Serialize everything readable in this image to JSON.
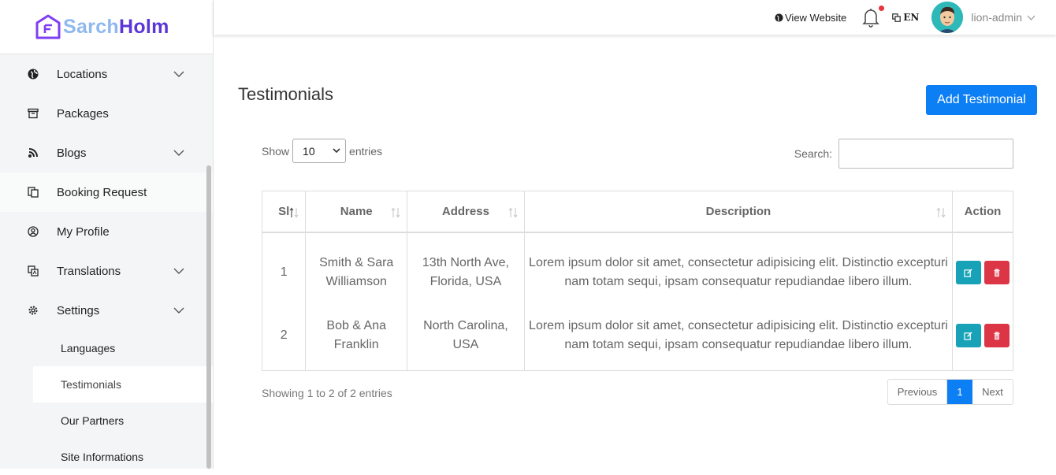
{
  "brand": {
    "part1": "Sarch",
    "part2": "Holm"
  },
  "sidebar": {
    "items": [
      {
        "label": "Locations",
        "icon": "globe-icon",
        "has_chevron": true
      },
      {
        "label": "Packages",
        "icon": "archive-icon",
        "has_chevron": false
      },
      {
        "label": "Blogs",
        "icon": "rss-icon",
        "has_chevron": true
      },
      {
        "label": "Booking Request",
        "icon": "copy-icon",
        "has_chevron": false
      },
      {
        "label": "My Profile",
        "icon": "user-circle-icon",
        "has_chevron": false
      },
      {
        "label": "Translations",
        "icon": "translate-icon",
        "has_chevron": true
      },
      {
        "label": "Settings",
        "icon": "gear-icon",
        "has_chevron": true
      }
    ],
    "subitems": [
      "Languages",
      "Testimonials",
      "Our Partners",
      "Site Informations"
    ]
  },
  "topbar": {
    "view_website": "View Website",
    "language": "EN",
    "username": "lion-admin"
  },
  "main": {
    "title": "Testimonials",
    "add_button": "Add Testimonial",
    "show_label": "Show",
    "entries_value": "10",
    "entries_label": "entries",
    "search_label": "Search:",
    "columns": [
      "Sl",
      "Name",
      "Address",
      "Description",
      "Action"
    ],
    "rows": [
      {
        "sl": "1",
        "name": "Smith & Sara Williamson",
        "address": "13th North Ave, Florida, USA",
        "description": "Lorem ipsum dolor sit amet, consectetur adipisicing elit. Distinctio excepturi nam totam sequi, ipsam consequatur repudiandae libero illum."
      },
      {
        "sl": "2",
        "name": "Bob & Ana Franklin",
        "address": "North Carolina, USA",
        "description": "Lorem ipsum dolor sit amet, consectetur adipisicing elit. Distinctio excepturi nam totam sequi, ipsam consequatur repudiandae libero illum."
      }
    ],
    "info": "Showing 1 to 2 of 2 entries",
    "pager": {
      "prev": "Previous",
      "page": "1",
      "next": "Next"
    }
  },
  "colors": {
    "primary": "#0d7ff5",
    "edit": "#17a2b8",
    "delete": "#dc3545",
    "brand_light": "#8fb8ef",
    "brand_dark": "#5a36d8"
  }
}
